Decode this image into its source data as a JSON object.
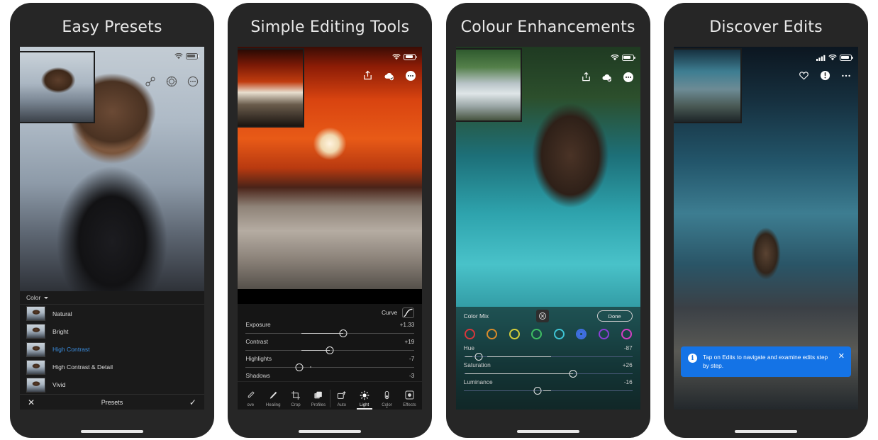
{
  "panels": [
    {
      "title": "Easy Presets",
      "status": {
        "wifi": "wifi-icon",
        "battery": "battery-icon"
      },
      "actions": [
        "link-icon",
        "target-adjust-icon",
        "more-options-icon"
      ],
      "photo": "portrait-woman-photo",
      "thumbnail": "before-thumbnail-portrait",
      "sheet": {
        "group_label": "Color",
        "group_chevron": "chevron-down-icon",
        "presets": [
          {
            "name": "Natural",
            "selected": false
          },
          {
            "name": "Bright",
            "selected": false
          },
          {
            "name": "High Contrast",
            "selected": true
          },
          {
            "name": "High Contrast & Detail",
            "selected": false
          },
          {
            "name": "Vivid",
            "selected": false
          }
        ],
        "bar": {
          "cancel": "✕",
          "title": "Presets",
          "confirm": "✓"
        }
      }
    },
    {
      "title": "Simple Editing Tools",
      "status": {
        "wifi": "wifi-icon",
        "battery": "battery-icon"
      },
      "actions": [
        "share-icon",
        "cloud-sync-icon",
        "more-options-icon"
      ],
      "photo": "torii-gate-tunnel-photo",
      "thumbnail": "before-thumbnail-tunnel",
      "sheet": {
        "curve_label": "Curve",
        "curve_icon": "tone-curve-icon",
        "sliders": [
          {
            "name": "Exposure",
            "value": "+1.33",
            "pos": 58,
            "fill_from": 33,
            "fill_to": 58
          },
          {
            "name": "Contrast",
            "value": "+19",
            "pos": 50,
            "fill_from": 33,
            "fill_to": 50
          },
          {
            "name": "Highlights",
            "value": "-7",
            "pos": 32,
            "fill_from": 32,
            "fill_to": 32
          },
          {
            "name": "Shadows",
            "value": "-3",
            "pos": 46,
            "fill_from": 46,
            "fill_to": 46
          }
        ],
        "tools": [
          {
            "label": "ove",
            "icon": "remove-tool-icon",
            "active": false,
            "divider": false
          },
          {
            "label": "Healing",
            "icon": "healing-brush-icon",
            "active": false,
            "divider": false
          },
          {
            "label": "Crop",
            "icon": "crop-icon",
            "active": false,
            "divider": false
          },
          {
            "label": "Profiles",
            "icon": "profiles-icon",
            "active": false,
            "divider": false
          },
          {
            "label": "Auto",
            "icon": "auto-icon",
            "active": false,
            "divider": true
          },
          {
            "label": "Light",
            "icon": "light-sun-icon",
            "active": true,
            "divider": false
          },
          {
            "label": "Color",
            "icon": "color-drop-icon",
            "active": false,
            "divider": false
          },
          {
            "label": "Effects",
            "icon": "effects-icon",
            "active": false,
            "divider": false
          }
        ]
      }
    },
    {
      "title": "Colour Enhancements",
      "status": {
        "wifi": "wifi-icon",
        "battery": "battery-icon"
      },
      "actions": [
        "share-icon",
        "cloud-sync-icon",
        "more-options-icon"
      ],
      "photo": "teal-truck-dog-photo",
      "thumbnail": "before-thumbnail-road",
      "sheet": {
        "title": "Color Mix",
        "target_icon": "target-adjust-icon",
        "done_label": "Done",
        "swatches": [
          {
            "name": "red",
            "color": "#d8373b",
            "selected": false
          },
          {
            "name": "orange",
            "color": "#d98b2b",
            "selected": false
          },
          {
            "name": "yellow",
            "color": "#d6cf3a",
            "selected": false
          },
          {
            "name": "green",
            "color": "#3fbf63",
            "selected": false
          },
          {
            "name": "aqua",
            "color": "#3fc5d6",
            "selected": false
          },
          {
            "name": "blue",
            "color": "#3f6fe0",
            "selected": true
          },
          {
            "name": "purple",
            "color": "#8b3fd6",
            "selected": false
          },
          {
            "name": "magenta",
            "color": "#d63fc5",
            "selected": false
          }
        ],
        "sliders": [
          {
            "name": "Hue",
            "value": "-87",
            "pos": 9,
            "fill_from": 9,
            "fill_to": 52
          },
          {
            "name": "Saturation",
            "value": "+26",
            "pos": 65,
            "fill_from": 1,
            "fill_to": 65
          },
          {
            "name": "Luminance",
            "value": "-16",
            "pos": 44,
            "fill_from": 44,
            "fill_to": 51
          }
        ]
      }
    },
    {
      "title": "Discover Edits",
      "status": {
        "cell": "cellular-signal-icon",
        "wifi": "wifi-icon",
        "battery": "battery-icon"
      },
      "actions": [
        "favorite-heart-icon",
        "info-icon",
        "more-options-icon"
      ],
      "photo": "waterfall-hiker-photo",
      "thumbnail": "before-thumbnail-waterfall",
      "tooltip": {
        "icon": "info-icon",
        "text": "Tap on Edits to navigate and examine edits step by step.",
        "close": "✕"
      }
    }
  ]
}
